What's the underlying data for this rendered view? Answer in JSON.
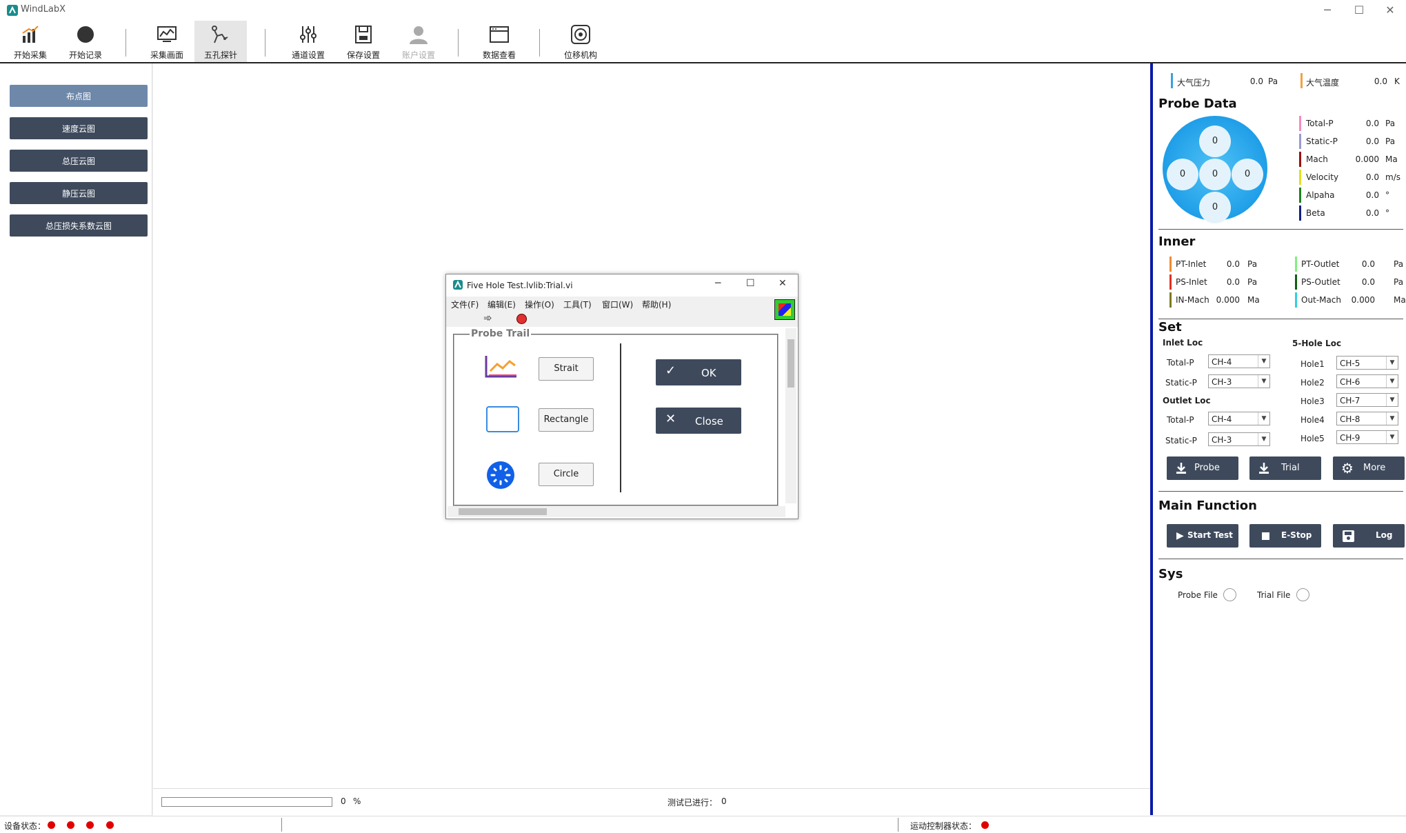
{
  "app": {
    "title": "WindLabX",
    "colors": {
      "accent": "#0a1aa8",
      "button": "#3e4a5c",
      "nav_active": "#6e88aa",
      "status_red": "#e00000"
    }
  },
  "window_controls": [
    "─",
    "☐",
    "✕"
  ],
  "toolbar": {
    "items": [
      {
        "label": "开始采集",
        "icon": "bar-chart-icon"
      },
      {
        "label": "开始记录",
        "icon": "record-circle-icon"
      },
      {
        "label": "采集画面",
        "icon": "monitor-chart-icon"
      },
      {
        "label": "五孔探针",
        "icon": "probe-arm-icon",
        "active": true
      },
      {
        "label": "通道设置",
        "icon": "sliders-icon"
      },
      {
        "label": "保存设置",
        "icon": "save-icon"
      },
      {
        "label": "账户设置",
        "icon": "user-icon",
        "disabled": true
      },
      {
        "label": "数据查看",
        "icon": "window-icon"
      },
      {
        "label": "位移机构",
        "icon": "target-icon"
      }
    ]
  },
  "leftnav": {
    "items": [
      "布点图",
      "速度云图",
      "总压云图",
      "静压云图",
      "总压损失系数云图"
    ],
    "active_index": 0
  },
  "footer": {
    "progress_value": "0",
    "progress_unit": "%",
    "progress_fraction": 0,
    "test_label": "测试已进行：",
    "test_value": "0"
  },
  "statusbar": {
    "device_label": "设备状态：",
    "motion_label": "运动控制器状态："
  },
  "right": {
    "atm": [
      {
        "label": "大气压力",
        "value": "0.0",
        "unit": "Pa",
        "color": "#3a9fe0"
      },
      {
        "label": "大气温度",
        "value": "0.0",
        "unit": "K",
        "color": "#f5a040"
      }
    ],
    "probe_title": "Probe Data",
    "holes": [
      "0",
      "0",
      "0",
      "0",
      "0"
    ],
    "probe_values": [
      {
        "label": "Total-P",
        "value": "0.0",
        "unit": "Pa",
        "color": "#f48bc0"
      },
      {
        "label": "Static-P",
        "value": "0.0",
        "unit": "Pa",
        "color": "#9a9ad0"
      },
      {
        "label": "Mach",
        "value": "0.000",
        "unit": "Ma",
        "color": "#9a1010"
      },
      {
        "label": "Velocity",
        "value": "0.0",
        "unit": "m/s",
        "color": "#e0e020"
      },
      {
        "label": "Alpaha",
        "value": "0.0",
        "unit": "°",
        "color": "#208020"
      },
      {
        "label": "Beta",
        "value": "0.0",
        "unit": "°",
        "color": "#102080"
      }
    ],
    "inner_title": "Inner",
    "inner_left": [
      {
        "label": "PT-Inlet",
        "value": "0.0",
        "unit": "Pa",
        "color": "#f08a30"
      },
      {
        "label": "PS-Inlet",
        "value": "0.0",
        "unit": "Pa",
        "color": "#e03020"
      },
      {
        "label": "IN-Mach",
        "value": "0.000",
        "unit": "Ma",
        "color": "#7a7a20"
      }
    ],
    "inner_right": [
      {
        "label": "PT-Outlet",
        "value": "0.0",
        "unit": "Pa",
        "color": "#80f080"
      },
      {
        "label": "PS-Outlet",
        "value": "0.0",
        "unit": "Pa",
        "color": "#106010"
      },
      {
        "label": "Out-Mach",
        "value": "0.000",
        "unit": "Ma",
        "color": "#30d0e0"
      }
    ],
    "set_title": "Set",
    "inlet_title": "Inlet Loc",
    "outlet_title": "Outlet Loc",
    "hole_loc_title": "5-Hole Loc",
    "inlet": [
      {
        "label": "Total-P",
        "value": "CH-4"
      },
      {
        "label": "Static-P",
        "value": "CH-3"
      }
    ],
    "outlet": [
      {
        "label": "Total-P",
        "value": "CH-4"
      },
      {
        "label": "Static-P",
        "value": "CH-3"
      }
    ],
    "holeloc": [
      {
        "label": "Hole1",
        "value": "CH-5"
      },
      {
        "label": "Hole2",
        "value": "CH-6"
      },
      {
        "label": "Hole3",
        "value": "CH-7"
      },
      {
        "label": "Hole4",
        "value": "CH-8"
      },
      {
        "label": "Hole5",
        "value": "CH-9"
      }
    ],
    "set_buttons": [
      "Probe",
      "Trial",
      "More"
    ],
    "main_title": "Main Function",
    "main_buttons": [
      "Start Test",
      "E-Stop",
      "Log"
    ],
    "sys_title": "Sys",
    "sys_options": [
      "Probe File",
      "Trial File"
    ]
  },
  "dialog": {
    "title": "Five Hole Test.lvlib:Trial.vi",
    "menu": [
      "文件(F)",
      "编辑(E)",
      "操作(O)",
      "工具(T)",
      "窗口(W)",
      "帮助(H)"
    ],
    "group_title": "Probe Trail",
    "trail_buttons": [
      "Strait",
      "Rectangle",
      "Circle"
    ],
    "ok_label": "OK",
    "close_label": "Close"
  }
}
